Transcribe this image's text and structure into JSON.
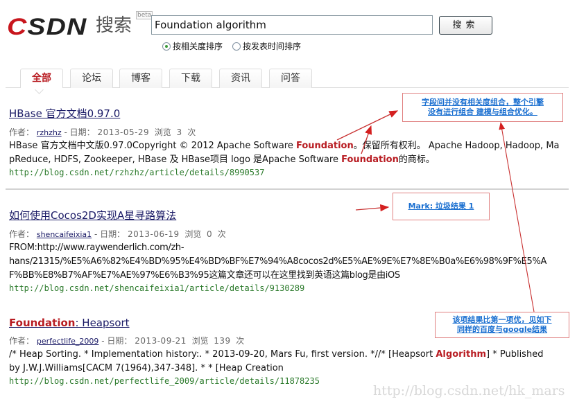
{
  "header": {
    "logo_text": "CSDN",
    "logo_subtitle": "搜索",
    "beta_badge": "beta",
    "search_value": "Foundation algorithm",
    "search_button": "搜索",
    "sort_options": [
      {
        "label": "按相关度排序",
        "selected": true
      },
      {
        "label": "按发表时间排序",
        "selected": false
      }
    ]
  },
  "tabs": [
    {
      "label": "全部",
      "active": true
    },
    {
      "label": "论坛",
      "active": false
    },
    {
      "label": "博客",
      "active": false
    },
    {
      "label": "下载",
      "active": false
    },
    {
      "label": "资讯",
      "active": false
    },
    {
      "label": "问答",
      "active": false
    }
  ],
  "results": [
    {
      "title": "HBase 官方文档0.97.0",
      "author_label": "作者：",
      "author": "rzhzhz",
      "date_label": "- 日期：",
      "date": "2013-05-29",
      "views_label": "浏览",
      "views": "3",
      "views_unit": "次",
      "desc_parts": [
        {
          "text": "HBase 官方文档中文版0.97.0Copyright © 2012 Apache Software ",
          "hl": false
        },
        {
          "text": "Foundation",
          "hl": true
        },
        {
          "text": "。保留所有权利。 Apache Hadoop, Hadoop, MapReduce, HDFS, Zookeeper, HBase 及 HBase项目 logo 是Apache Software ",
          "hl": false
        },
        {
          "text": "Foundation",
          "hl": true
        },
        {
          "text": "的商标。",
          "hl": false
        }
      ],
      "url": "http://blog.csdn.net/rzhzhz/article/details/8990537"
    },
    {
      "title": "如何使用Cocos2D实现A星寻路算法",
      "author_label": "作者：",
      "author": "shencaifeixia1",
      "date_label": "- 日期：",
      "date": "2013-06-19",
      "views_label": "浏览",
      "views": "0",
      "views_unit": "次",
      "desc_lines": [
        "FROM:http://www.raywenderlich.com/zh-",
        "hans/21315/%E5%A6%82%E4%BD%95%E4%BD%BF%E7%94%A8cocos2d%E5%AE%9E%E7%8E%B0a%E6%98%9F%E5%A",
        "F%BB%E8%B7%AF%E7%AE%97%E6%B3%95这篇文章还可以在这里找到英语这篇blog是由iOS"
      ],
      "url": "http://blog.csdn.net/shencaifeixia1/article/details/9130289"
    },
    {
      "title_hl": "Foundation",
      "title_rest": ": Heapsort",
      "author_label": "作者：",
      "author": "perfectlife_2009",
      "date_label": "- 日期：",
      "date": "2013-09-21",
      "views_label": "浏览",
      "views": "139",
      "views_unit": "次",
      "desc_parts": [
        {
          "text": "/* Heap Sorting. * Implementation history:. * 2013-09-20, Mars Fu, first version. *//* [Heapsort ",
          "hl": false
        },
        {
          "text": "Algorithm",
          "hl": true
        },
        {
          "text": "] * Published by J.W.J.Williams[CACM 7(1964),347-348]. * * [Heap Creation",
          "hl": false
        }
      ],
      "url": "http://blog.csdn.net/perfectlife_2009/article/details/11878235"
    }
  ],
  "annotations": {
    "note1_line1": "字段间并没有相关度组合，整个引擎",
    "note1_line2": "没有进行组合 建模与组合优化。",
    "note2": "Mark: 垃圾结果 1",
    "note3_line1": "该项结果比第一项优，见如下",
    "note3_line2": "同样的百度与google结果",
    "arrow_color": "#d42020"
  },
  "watermark": "http://blog.csdn.net/hk_mars"
}
